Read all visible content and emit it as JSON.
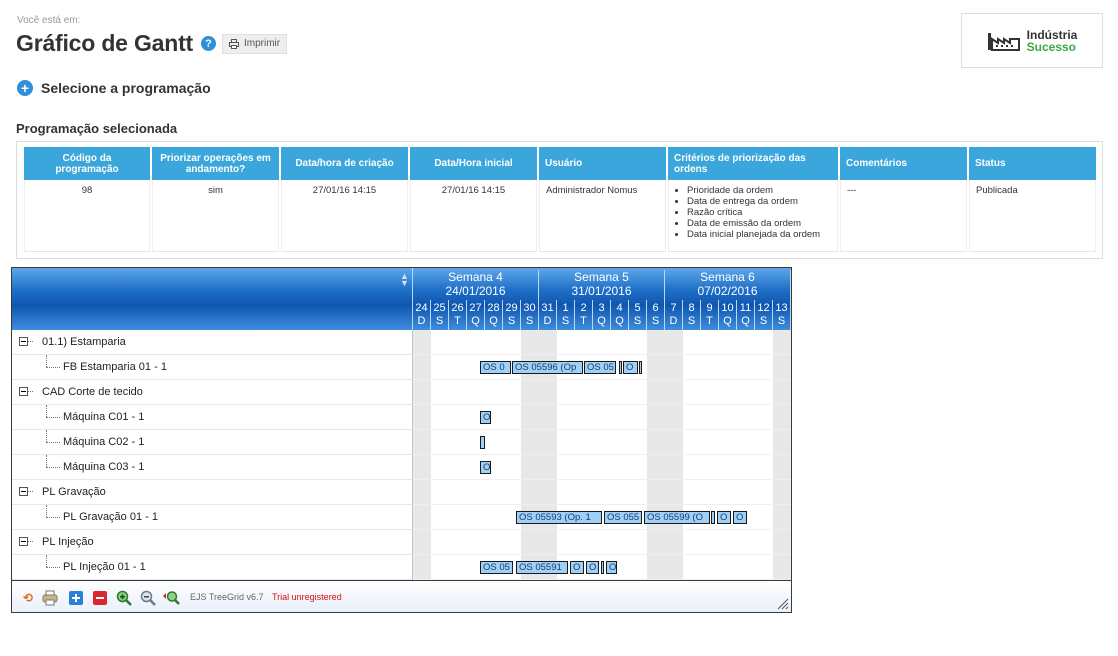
{
  "header": {
    "breadcrumb": "Você está em:",
    "title": "Gráfico de Gantt",
    "help_icon": "question-circle-icon",
    "print_label": "Imprimir",
    "logo": {
      "line1": "Indústria",
      "line2": "Sucesso"
    }
  },
  "selector": {
    "label": "Selecione a programação"
  },
  "selected_section": {
    "title": "Programação selecionada"
  },
  "program_table": {
    "columns": [
      "Código da programação",
      "Priorizar operações em andamento?",
      "Data/hora de criação",
      "Data/Hora inicial",
      "Usuário",
      "Critérios de priorização das ordens",
      "Comentários",
      "Status"
    ],
    "row": {
      "codigo": "98",
      "priorizar": "sim",
      "criacao": "27/01/16 14:15",
      "inicial": "27/01/16 14:15",
      "usuario": "Administrador Nomus",
      "criterios": [
        "Prioridade da ordem",
        "Data de entrega da ordem",
        "Razão crítica",
        "Data de emissão da ordem",
        "Data inicial planejada da ordem"
      ],
      "comentarios": "---",
      "status": "Publicada"
    }
  },
  "gantt": {
    "weeks": [
      {
        "name": "Semana 4",
        "date": "24/01/2016"
      },
      {
        "name": "Semana 5",
        "date": "31/01/2016"
      },
      {
        "name": "Semana 6",
        "date": "07/02/2016"
      }
    ],
    "days": [
      {
        "n": "24",
        "d": "D"
      },
      {
        "n": "25",
        "d": "S"
      },
      {
        "n": "26",
        "d": "T"
      },
      {
        "n": "27",
        "d": "Q"
      },
      {
        "n": "28",
        "d": "Q"
      },
      {
        "n": "29",
        "d": "S"
      },
      {
        "n": "30",
        "d": "S"
      },
      {
        "n": "31",
        "d": "D"
      },
      {
        "n": "1",
        "d": "S"
      },
      {
        "n": "2",
        "d": "T"
      },
      {
        "n": "3",
        "d": "Q"
      },
      {
        "n": "4",
        "d": "Q"
      },
      {
        "n": "5",
        "d": "S"
      },
      {
        "n": "6",
        "d": "S"
      },
      {
        "n": "7",
        "d": "D"
      },
      {
        "n": "8",
        "d": "S"
      },
      {
        "n": "9",
        "d": "T"
      },
      {
        "n": "10",
        "d": "Q"
      },
      {
        "n": "11",
        "d": "Q"
      },
      {
        "n": "12",
        "d": "S"
      },
      {
        "n": "13",
        "d": "S"
      }
    ],
    "rows": [
      {
        "label": "01.1) Estamparia",
        "group": true
      },
      {
        "label": "FB Estamparia 01 - 1",
        "group": false,
        "bars": [
          {
            "text": "OS 0"
          },
          {
            "text": "OS 05596 (Op"
          },
          {
            "text": "OS 05"
          },
          {
            "text": ""
          },
          {
            "text": "O"
          },
          {
            "text": ""
          }
        ]
      },
      {
        "label": "CAD Corte de tecido",
        "group": true
      },
      {
        "label": "Máquina C01 - 1",
        "group": false,
        "bars": [
          {
            "text": "O"
          }
        ]
      },
      {
        "label": "Máquina C02 - 1",
        "group": false,
        "bars": [
          {
            "text": ""
          }
        ]
      },
      {
        "label": "Máquina C03 - 1",
        "group": false,
        "bars": [
          {
            "text": "O"
          }
        ]
      },
      {
        "label": "PL Gravação",
        "group": true
      },
      {
        "label": "PL Gravação 01 - 1",
        "group": false,
        "bars": [
          {
            "text": "OS 05593 (Op. 1"
          },
          {
            "text": "OS 055"
          },
          {
            "text": "OS 05599 (O"
          },
          {
            "text": ""
          },
          {
            "text": "O"
          },
          {
            "text": "O"
          }
        ]
      },
      {
        "label": "PL Injeção",
        "group": true
      },
      {
        "label": "PL Injeção 01 - 1",
        "group": false,
        "bars": [
          {
            "text": "OS 05"
          },
          {
            "text": "OS 05591"
          },
          {
            "text": "O"
          },
          {
            "text": "O"
          },
          {
            "text": ""
          },
          {
            "text": "O"
          }
        ]
      }
    ],
    "toolbar": {
      "icons": [
        "reload-icon",
        "print-icon",
        "expand-all-icon",
        "collapse-all-icon",
        "zoom-in-icon",
        "zoom-out-icon",
        "zoom-fit-icon"
      ],
      "product": "EJS TreeGrid v6.7",
      "trial": "Trial unregistered"
    }
  }
}
